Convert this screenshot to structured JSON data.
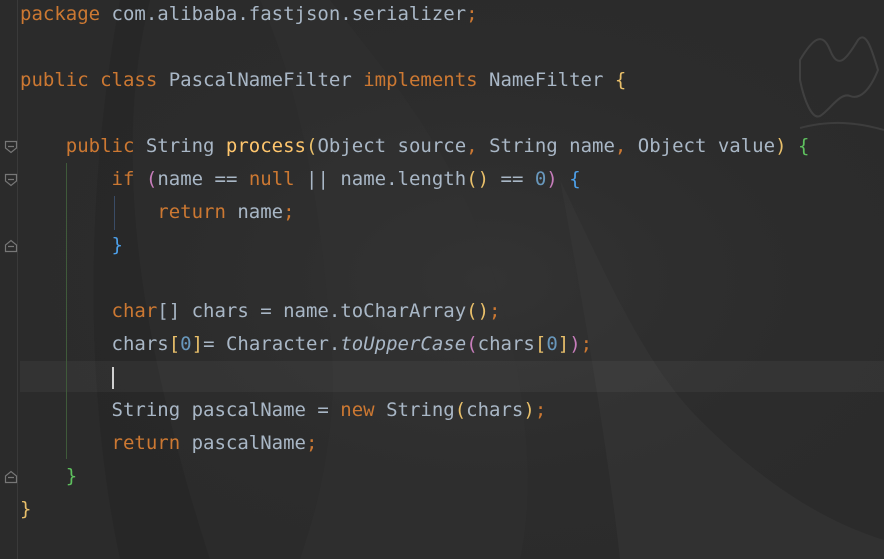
{
  "editor": {
    "language": "Java",
    "lines": [
      {
        "segments": [
          {
            "t": "package",
            "c": "kw"
          },
          {
            "t": " com.alibaba.fastjson.serializer",
            "c": "id"
          },
          {
            "t": ";",
            "c": "kw"
          }
        ]
      },
      {
        "segments": []
      },
      {
        "segments": [
          {
            "t": "public",
            "c": "kw"
          },
          {
            "t": " ",
            "c": "id"
          },
          {
            "t": "class",
            "c": "kw"
          },
          {
            "t": " PascalNameFilter ",
            "c": "id"
          },
          {
            "t": "implements",
            "c": "kw"
          },
          {
            "t": " NameFilter ",
            "c": "id"
          },
          {
            "t": "{",
            "c": "b1"
          }
        ]
      },
      {
        "segments": []
      },
      {
        "segments": [
          {
            "t": "    ",
            "c": "id"
          },
          {
            "t": "public",
            "c": "kw"
          },
          {
            "t": " String ",
            "c": "id"
          },
          {
            "t": "process",
            "c": "fn"
          },
          {
            "t": "(",
            "c": "b1"
          },
          {
            "t": "Object source",
            "c": "id"
          },
          {
            "t": ", ",
            "c": "kw"
          },
          {
            "t": "String name",
            "c": "id"
          },
          {
            "t": ", ",
            "c": "kw"
          },
          {
            "t": "Object value",
            "c": "id"
          },
          {
            "t": ")",
            "c": "b1"
          },
          {
            "t": " ",
            "c": "id"
          },
          {
            "t": "{",
            "c": "b4"
          }
        ]
      },
      {
        "segments": [
          {
            "t": "        ",
            "c": "id"
          },
          {
            "t": "if",
            "c": "kw"
          },
          {
            "t": " ",
            "c": "id"
          },
          {
            "t": "(",
            "c": "b2"
          },
          {
            "t": "name == ",
            "c": "id"
          },
          {
            "t": "null",
            "c": "kw"
          },
          {
            "t": " || name.length",
            "c": "id"
          },
          {
            "t": "()",
            "c": "b1"
          },
          {
            "t": " == ",
            "c": "id"
          },
          {
            "t": "0",
            "c": "num"
          },
          {
            "t": ")",
            "c": "b2"
          },
          {
            "t": " ",
            "c": "id"
          },
          {
            "t": "{",
            "c": "b3"
          }
        ]
      },
      {
        "segments": [
          {
            "t": "            ",
            "c": "id"
          },
          {
            "t": "return",
            "c": "kw"
          },
          {
            "t": " name",
            "c": "id"
          },
          {
            "t": ";",
            "c": "kw"
          }
        ]
      },
      {
        "segments": [
          {
            "t": "        ",
            "c": "id"
          },
          {
            "t": "}",
            "c": "b3"
          }
        ]
      },
      {
        "segments": []
      },
      {
        "segments": [
          {
            "t": "        ",
            "c": "id"
          },
          {
            "t": "char",
            "c": "kw"
          },
          {
            "t": "[] chars = name.toCharArray",
            "c": "id"
          },
          {
            "t": "()",
            "c": "b1"
          },
          {
            "t": ";",
            "c": "kw"
          }
        ]
      },
      {
        "segments": [
          {
            "t": "        ",
            "c": "id"
          },
          {
            "t": "chars",
            "c": "id"
          },
          {
            "t": "[",
            "c": "b1"
          },
          {
            "t": "0",
            "c": "num"
          },
          {
            "t": "]",
            "c": "b1"
          },
          {
            "t": "= Character.",
            "c": "id"
          },
          {
            "t": "toUpperCase",
            "c": "st"
          },
          {
            "t": "(",
            "c": "b2"
          },
          {
            "t": "chars",
            "c": "id"
          },
          {
            "t": "[",
            "c": "b1"
          },
          {
            "t": "0",
            "c": "num"
          },
          {
            "t": "]",
            "c": "b1"
          },
          {
            "t": ")",
            "c": "b2"
          },
          {
            "t": ";",
            "c": "kw"
          }
        ]
      },
      {
        "segments": [],
        "caret": true
      },
      {
        "segments": [
          {
            "t": "        ",
            "c": "id"
          },
          {
            "t": "String pascalName = ",
            "c": "id"
          },
          {
            "t": "new",
            "c": "kw"
          },
          {
            "t": " String",
            "c": "id"
          },
          {
            "t": "(",
            "c": "b1"
          },
          {
            "t": "chars",
            "c": "id"
          },
          {
            "t": ")",
            "c": "b1"
          },
          {
            "t": ";",
            "c": "kw"
          }
        ]
      },
      {
        "segments": [
          {
            "t": "        ",
            "c": "id"
          },
          {
            "t": "return",
            "c": "kw"
          },
          {
            "t": " pascalName",
            "c": "id"
          },
          {
            "t": ";",
            "c": "kw"
          }
        ]
      },
      {
        "segments": [
          {
            "t": "    ",
            "c": "id"
          },
          {
            "t": "}",
            "c": "b4"
          }
        ]
      },
      {
        "segments": [
          {
            "t": "}",
            "c": "b1"
          }
        ]
      }
    ]
  },
  "folds": [
    {
      "line": 4,
      "kind": "open"
    },
    {
      "line": 5,
      "kind": "open"
    },
    {
      "line": 7,
      "kind": "close"
    },
    {
      "line": 14,
      "kind": "close"
    }
  ]
}
